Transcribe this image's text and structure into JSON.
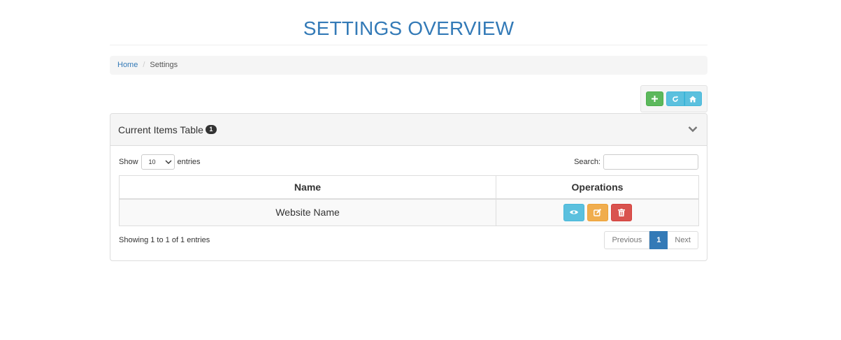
{
  "header": {
    "title": "SETTINGS OVERVIEW"
  },
  "breadcrumb": {
    "home": "Home",
    "separator": "/",
    "current": "Settings"
  },
  "toolbar": {
    "buttons": [
      {
        "icon": "plus-icon",
        "color": "#5cb85c"
      },
      {
        "icon": "refresh-icon",
        "color": "#5bc0de"
      },
      {
        "icon": "home-icon",
        "color": "#5bc0de"
      }
    ]
  },
  "panel": {
    "title": "Current Items Table",
    "badge": "1",
    "toggle_icon": "chevron-down-icon"
  },
  "datatable": {
    "length_prefix": "Show",
    "length_value": "10",
    "length_suffix": "entries",
    "search_label": "Search:",
    "search_value": "",
    "columns": [
      "Name",
      "Operations"
    ],
    "rows": [
      {
        "name": "Website Name",
        "operations": [
          "view-icon",
          "edit-icon",
          "delete-icon"
        ]
      }
    ],
    "info": "Showing 1 to 1 of 1 entries",
    "pagination": {
      "previous": "Previous",
      "current": "1",
      "next": "Next"
    }
  },
  "colors": {
    "primary": "#337ab7",
    "success": "#5cb85c",
    "info": "#5bc0de",
    "warning": "#f0ad4e",
    "danger": "#d9534f"
  }
}
